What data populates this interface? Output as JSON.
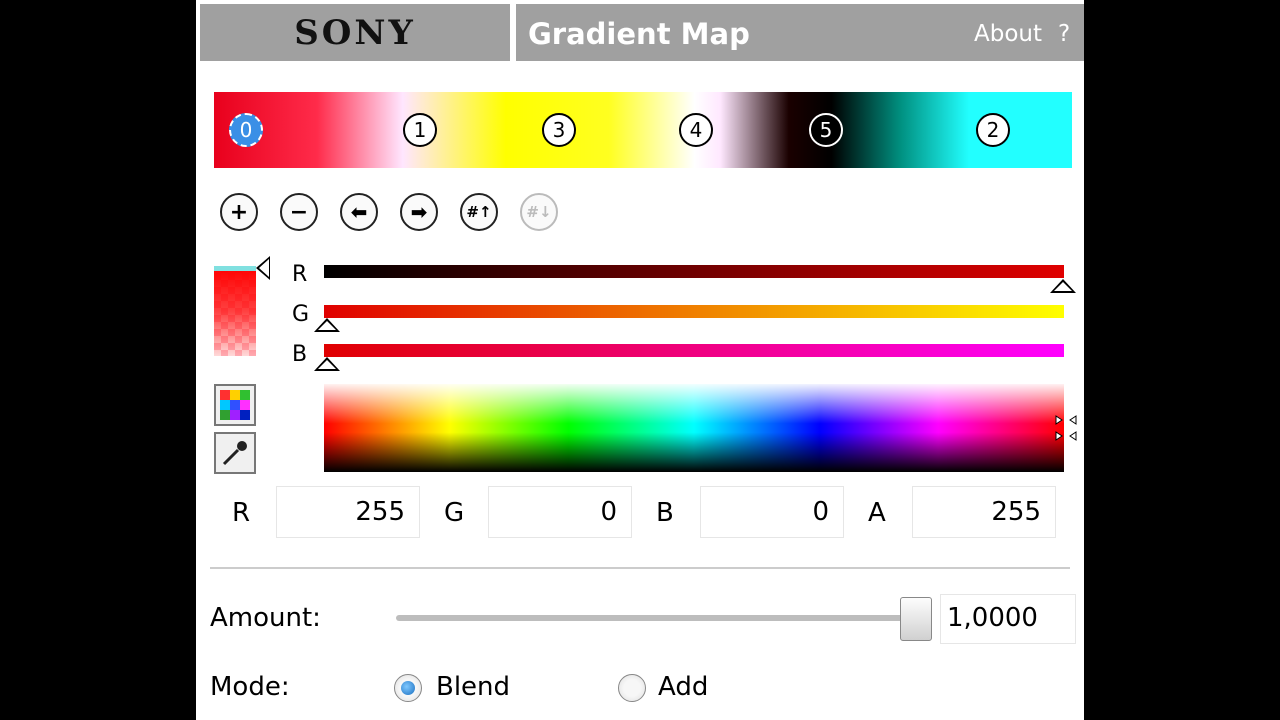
{
  "header": {
    "logo": "SONY",
    "title": "Gradient Map",
    "about": "About",
    "help": "?"
  },
  "gradient": {
    "stops": [
      "0",
      "1",
      "3",
      "4",
      "5",
      "2"
    ],
    "selected_stop": "0"
  },
  "toolbar": {
    "buttons": [
      "add-stop",
      "remove-stop",
      "move-left",
      "move-right",
      "distribute",
      "reverse"
    ],
    "glyphs": [
      "+",
      "−",
      "⬅",
      "➡",
      "#↑",
      "#↓"
    ]
  },
  "channels": {
    "labels": [
      "R",
      "G",
      "B"
    ]
  },
  "values": {
    "r_label": "R",
    "r_value": "255",
    "g_label": "G",
    "g_value": "0",
    "b_label": "B",
    "b_value": "0",
    "a_label": "A",
    "a_value": "255"
  },
  "amount": {
    "label": "Amount:",
    "value": "1,0000",
    "slider_fraction": 1.0
  },
  "mode": {
    "label": "Mode:",
    "options": [
      "Blend",
      "Add"
    ],
    "selected": "Blend"
  },
  "colors": {
    "header_bg": "#a0a0a0",
    "selected_stop": "#3a8fe6",
    "current_color": "#ff0000"
  }
}
